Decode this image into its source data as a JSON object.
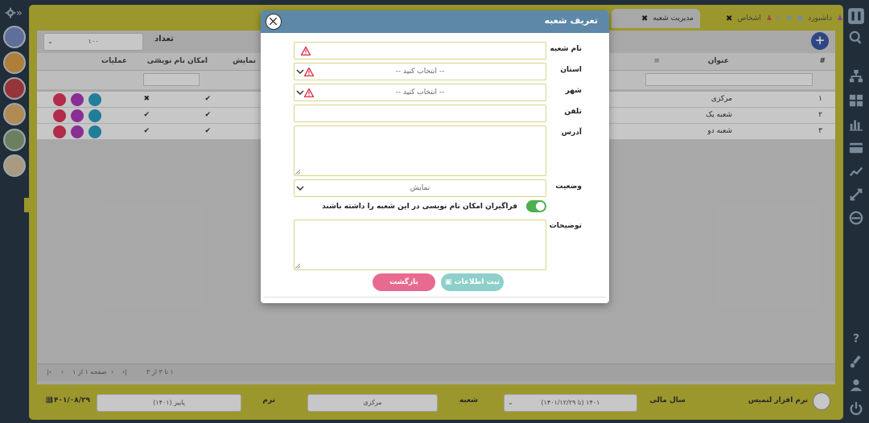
{
  "tabs": [
    {
      "label": "مدیریت شعبه",
      "active": true
    },
    {
      "label": "اشخاص",
      "active": false
    },
    {
      "label": "داشبورد",
      "active": false
    }
  ],
  "list": {
    "count_label": "تعداد",
    "count_value": "۱۰۰",
    "columns": [
      "#",
      "عنوان",
      "نمایش",
      "امکان نام نویسی",
      "عملیات"
    ],
    "rows": [
      {
        "num": "۱",
        "title": "مرکزی",
        "show": true,
        "register": false
      },
      {
        "num": "۲",
        "title": "شعبه یک",
        "show": true,
        "register": true
      },
      {
        "num": "۳",
        "title": "شعبه دو",
        "show": true,
        "register": true
      }
    ],
    "pager": {
      "page_text": "صفحه ۱ از ۱",
      "range_text": "۱ تا ۳ از ۳"
    }
  },
  "status": {
    "app_name": "نرم افزار لنمیس",
    "fiscal_label": "سال مالی",
    "fiscal_value": "۱۴۰۱ (تا ۱۴۰۱/۱۲/۲۹)",
    "branch_label": "شعبه",
    "branch_value": "مرکزی",
    "term_label": "ترم",
    "term_value": "پاییز (۱۴۰۱)",
    "date": "۱۴۰۱/۰۸/۲۹"
  },
  "modal": {
    "title": "تعریف شعبه",
    "fields": {
      "name_label": "نام شعبه",
      "province_label": "استان",
      "province_placeholder": "-- انتخاب کنید --",
      "city_label": "شهر",
      "city_placeholder": "-- انتخاب کنید --",
      "phone_label": "تلفن",
      "address_label": "آدرس",
      "status_label": "وضعیت",
      "status_value": "نمایش",
      "toggle_label": "فراگیران امکان نام نویسی در این شعبه را داشته باشند",
      "desc_label": "توضیحات"
    },
    "buttons": {
      "save": "ثبت اطلاعات",
      "back": "بازگشت"
    }
  },
  "colors": {
    "accent": "#5d88a8",
    "frame": "#c8c23a",
    "sidebar": "#2b3a4a",
    "save": "#8fcfcb",
    "back": "#e86a8f",
    "toggle": "#4caf50"
  }
}
